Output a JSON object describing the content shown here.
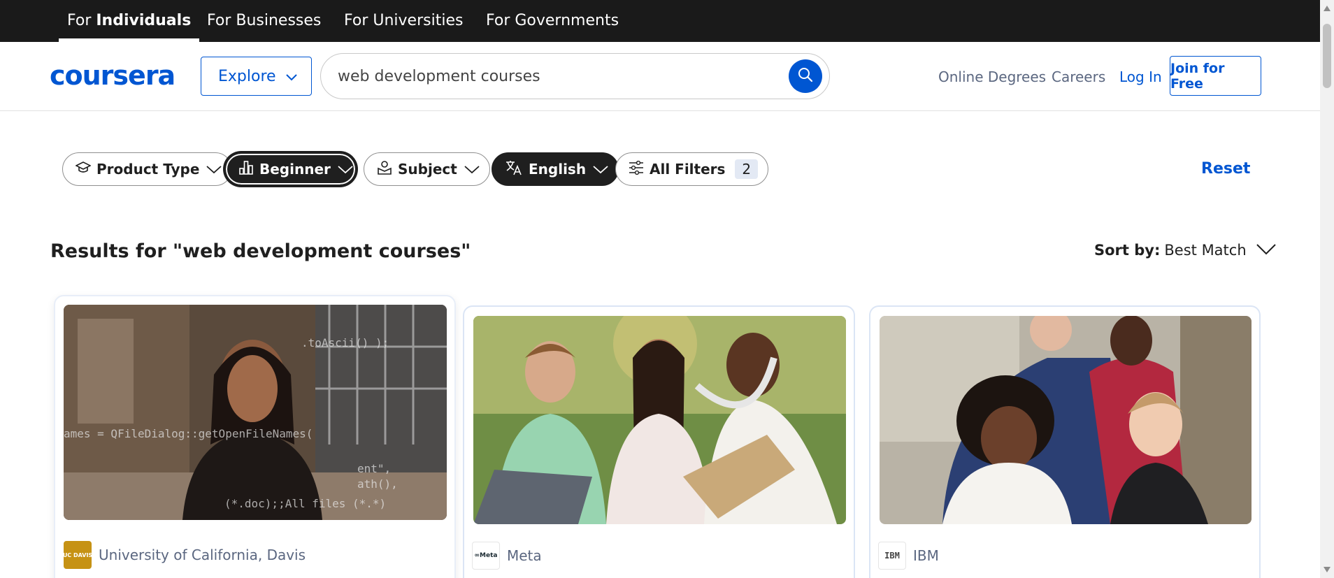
{
  "segments": [
    {
      "prefix": "For ",
      "bold": "Individuals",
      "label": "For Individuals"
    },
    {
      "label": "For Businesses"
    },
    {
      "label": "For Universities"
    },
    {
      "label": "For Governments"
    }
  ],
  "header": {
    "logo": "coursera",
    "explore": "Explore",
    "search_value": "web development courses",
    "links": {
      "online_degrees": "Online Degrees",
      "careers": "Careers",
      "login": "Log In",
      "join": "Join for Free"
    }
  },
  "filters": {
    "product_type": "Product Type",
    "level": "Beginner",
    "subject": "Subject",
    "language": "English",
    "all_filters": "All Filters",
    "all_filters_count": "2",
    "reset": "Reset"
  },
  "results": {
    "title": "Results for \"web development courses\"",
    "sort_label": "Sort by:",
    "sort_value": "Best Match"
  },
  "cards": [
    {
      "partner": "University of California, Davis",
      "logo_text": "UC DAVIS"
    },
    {
      "partner": "Meta",
      "logo_text": "∞Meta"
    },
    {
      "partner": "IBM",
      "logo_text": "IBM"
    }
  ],
  "colors": {
    "brand": "#0056d2",
    "topbar": "#1a1a1a",
    "dark_chip": "#1f1f1f"
  }
}
